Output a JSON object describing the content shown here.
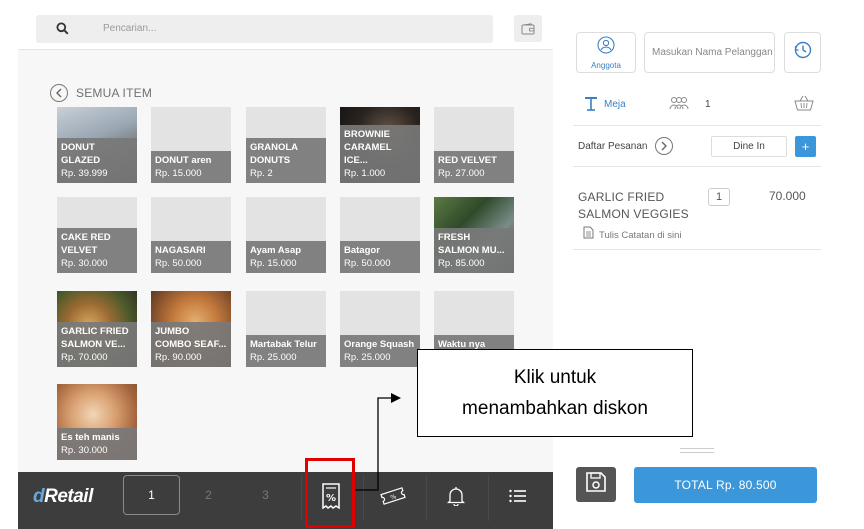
{
  "search": {
    "placeholder": "Pencarian..."
  },
  "category": {
    "label": "SEMUA ITEM"
  },
  "products": [
    {
      "name": "DONUT\nGLAZED",
      "price": "Rp. 39.999",
      "image": "glazed-donut-photo"
    },
    {
      "name": "DONUT aren",
      "price": "Rp. 15.000",
      "image": "none"
    },
    {
      "name": "GRANOLA\nDONUTS",
      "price": "Rp. 2",
      "image": "none"
    },
    {
      "name": "BROWNIE\nCARAMEL ICE...",
      "price": "Rp. 1.000",
      "image": "brownie-photo"
    },
    {
      "name": "RED VELVET",
      "price": "Rp. 27.000",
      "image": "none"
    },
    {
      "name": "CAKE RED\nVELVET",
      "price": "Rp. 30.000",
      "image": "none"
    },
    {
      "name": "NAGASARI",
      "price": "Rp. 50.000",
      "image": "none"
    },
    {
      "name": "Ayam Asap",
      "price": "Rp. 15.000",
      "image": "none"
    },
    {
      "name": "Batagor",
      "price": "Rp. 50.000",
      "image": "none"
    },
    {
      "name": "FRESH\nSALMON MU...",
      "price": "Rp. 85.000",
      "image": "salmon-photo"
    },
    {
      "name": "GARLIC FRIED\nSALMON  VE...",
      "price": "Rp. 70.000",
      "image": "garlic-salmon-photo"
    },
    {
      "name": "JUMBO\nCOMBO SEAF...",
      "price": "Rp. 90.000",
      "image": "seafood-combo-photo"
    },
    {
      "name": "Martabak Telur",
      "price": "Rp. 25.000",
      "image": "none"
    },
    {
      "name": "Orange Squash",
      "price": "Rp. 25.000",
      "image": "none"
    },
    {
      "name": "Waktu nya\nseumur hidup",
      "price": "",
      "image": "none"
    },
    {
      "name": "Es teh manis",
      "price": "Rp. 30.000",
      "image": "iced-tea-photo"
    }
  ],
  "bottombar": {
    "logo_d": "d",
    "logo_rest": "Retail",
    "pages": [
      "1",
      "2",
      "3"
    ],
    "active_page": "1"
  },
  "customer": {
    "member_label": "Anggota",
    "name_placeholder": "Masukan Nama Pelanggan"
  },
  "table": {
    "label": "Meja",
    "guests": "1"
  },
  "order": {
    "list_label": "Daftar Pesanan",
    "type": "Dine In",
    "add_label": "+",
    "items": [
      {
        "name": "GARLIC FRIED\nSALMON  VEGGIES",
        "qty": "1",
        "price": "70.000",
        "note_placeholder": "Tulis Catatan di sini"
      }
    ]
  },
  "total": {
    "label": "TOTAL Rp. 80.500"
  },
  "callout": {
    "line1": "Klik untuk",
    "line2": "menambahkan diskon"
  },
  "colors": {
    "accent": "#3b97d9",
    "highlight": "#e10000",
    "bar": "#3d3d3d"
  }
}
